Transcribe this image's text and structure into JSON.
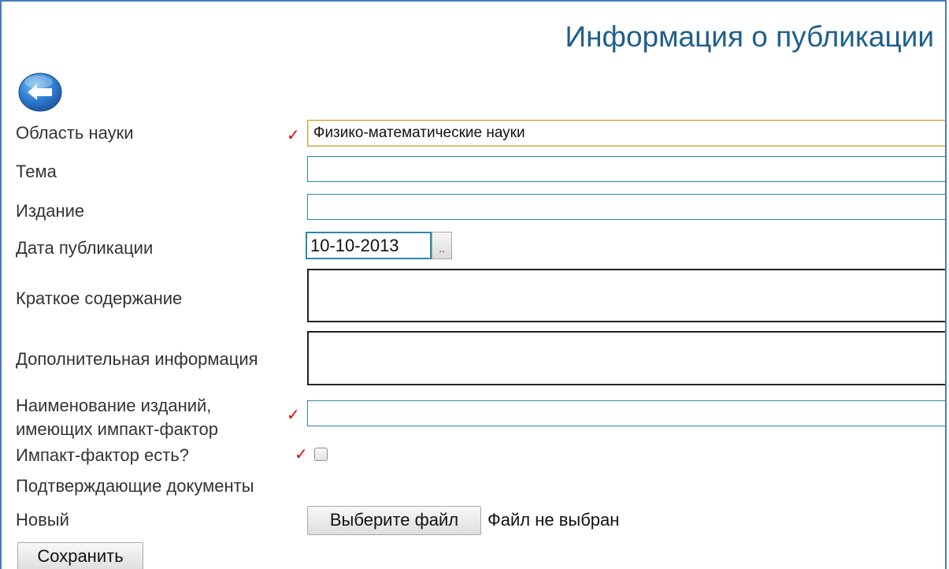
{
  "page": {
    "title": "Информация о публикации"
  },
  "icons": {
    "back": "back-arrow-icon"
  },
  "colors": {
    "title": "#1f5f8b",
    "required_mark": "#e00000",
    "input_border": "#2a8aa5"
  },
  "form": {
    "field_of_science": {
      "label": "Область науки",
      "value": "Физико-математические науки",
      "required_mark": "✓"
    },
    "topic": {
      "label": "Тема",
      "value": ""
    },
    "edition": {
      "label": "Издание",
      "value": ""
    },
    "publication_date": {
      "label": "Дата публикации",
      "value": "10-10-2013",
      "picker_label": ".."
    },
    "summary": {
      "label": "Краткое содержание",
      "value": ""
    },
    "additional_info": {
      "label": "Дополнительная информация",
      "value": ""
    },
    "impact_editions": {
      "label_line1": "Наименование изданий,",
      "label_line2": "имеющих импакт-фактор",
      "value": "",
      "required_mark": "✓"
    },
    "has_impact_factor": {
      "label": "Импакт-фактор есть?",
      "checked": false,
      "required_mark": "✓"
    },
    "supporting_docs": {
      "label": "Подтверждающие документы"
    },
    "new_file": {
      "label": "Новый",
      "button_label": "Выберите файл",
      "status": "Файл не выбран"
    },
    "save_label": "Сохранить"
  }
}
